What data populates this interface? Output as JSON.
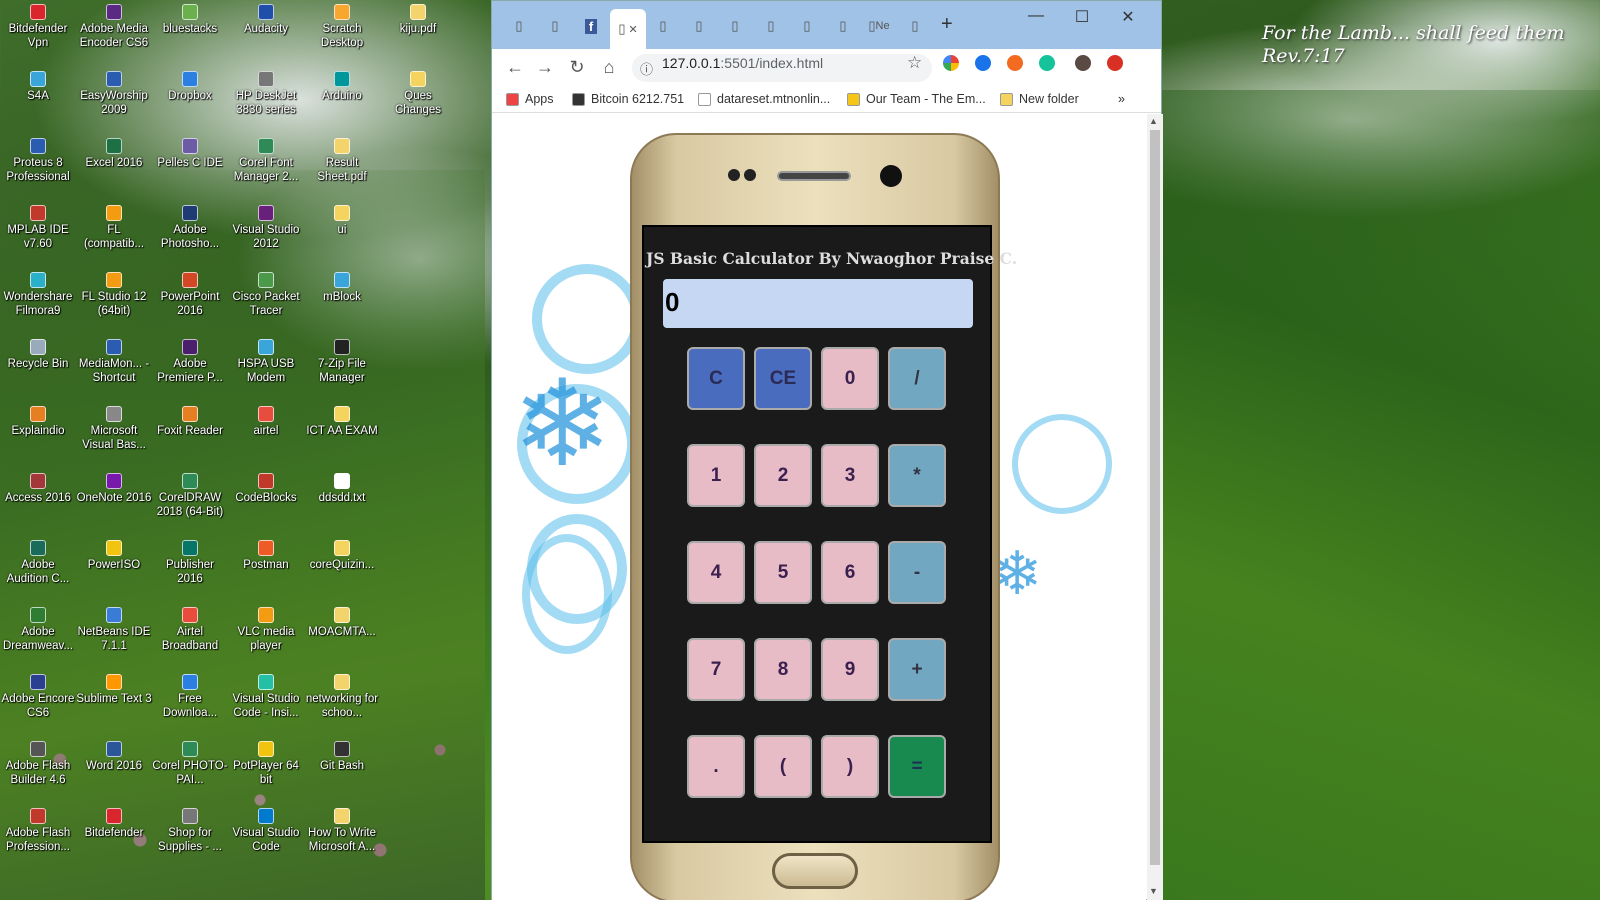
{
  "desktop": {
    "quote": "For the Lamb... shall feed them\nRev.7:17",
    "icons": [
      {
        "label": "Bitdefender Vpn",
        "icon": "bitdefender-vpn-icon",
        "color": "#d9262c"
      },
      {
        "label": "Adobe Media Encoder CS6",
        "icon": "adobe-media-encoder-icon",
        "color": "#5a2a82"
      },
      {
        "label": "bluestacks",
        "icon": "bluestacks-icon",
        "color": "#6ab04c"
      },
      {
        "label": "Audacity",
        "icon": "audacity-icon",
        "color": "#1f4fa8"
      },
      {
        "label": "Scratch Desktop",
        "icon": "scratch-icon",
        "color": "#f7a630"
      },
      {
        "label": "kiju.pdf",
        "icon": "pdf-file-icon",
        "color": "#f3d36b"
      },
      {
        "label": "S4A",
        "icon": "s4a-icon",
        "color": "#3aa5d8"
      },
      {
        "label": "EasyWorship 2009",
        "icon": "easyworship-icon",
        "color": "#2a5db0"
      },
      {
        "label": "Dropbox",
        "icon": "dropbox-icon",
        "color": "#2a7fe0"
      },
      {
        "label": "HP DeskJet 3830 series",
        "icon": "printer-icon",
        "color": "#777777"
      },
      {
        "label": "Arduino",
        "icon": "arduino-icon",
        "color": "#00979c"
      },
      {
        "label": "Ques Changes",
        "icon": "folder-icon",
        "color": "#f4d35e"
      },
      {
        "label": "Proteus 8 Professional",
        "icon": "proteus-icon",
        "color": "#2a5db0"
      },
      {
        "label": "Excel 2016",
        "icon": "excel-icon",
        "color": "#1d7044"
      },
      {
        "label": "Pelles C IDE",
        "icon": "pelles-c-icon",
        "color": "#6b5ca5"
      },
      {
        "label": "Corel Font Manager 2...",
        "icon": "corel-font-icon",
        "color": "#2e8b57"
      },
      {
        "label": "Result Sheet.pdf",
        "icon": "pdf-file-icon",
        "color": "#f3d36b"
      },
      {
        "label": "MPLAB IDE v7.60",
        "icon": "mplab-icon",
        "color": "#c0392b"
      },
      {
        "label": "FL (compatib...",
        "icon": "fl-studio-icon",
        "color": "#f39c12"
      },
      {
        "label": "Adobe Photosho...",
        "icon": "photoshop-icon",
        "color": "#1f3b73"
      },
      {
        "label": "Visual Studio 2012",
        "icon": "visual-studio-icon",
        "color": "#68217a"
      },
      {
        "label": "ui",
        "icon": "folder-icon",
        "color": "#f4d35e"
      },
      {
        "label": "Wondershare Filmora9",
        "icon": "filmora-icon",
        "color": "#2ab0c8"
      },
      {
        "label": "FL Studio 12 (64bit)",
        "icon": "fl-studio-icon",
        "color": "#f39c12"
      },
      {
        "label": "PowerPoint 2016",
        "icon": "powerpoint-icon",
        "color": "#d24726"
      },
      {
        "label": "Cisco Packet Tracer",
        "icon": "packet-tracer-icon",
        "color": "#4a9a4a"
      },
      {
        "label": "mBlock",
        "icon": "mblock-icon",
        "color": "#3aa5d8"
      },
      {
        "label": "Recycle Bin",
        "icon": "recycle-bin-icon",
        "color": "#9ab"
      },
      {
        "label": "MediaMon... - Shortcut",
        "icon": "mediamonkey-icon",
        "color": "#2a5db0"
      },
      {
        "label": "Adobe Premiere P...",
        "icon": "premiere-icon",
        "color": "#4a1f6b"
      },
      {
        "label": "HSPA USB Modem",
        "icon": "modem-icon",
        "color": "#3aa5d8"
      },
      {
        "label": "7-Zip File Manager",
        "icon": "7zip-icon",
        "color": "#222222"
      },
      {
        "label": "Explaindio",
        "icon": "explaindio-icon",
        "color": "#e67e22"
      },
      {
        "label": "Microsoft Visual Bas...",
        "icon": "visual-basic-icon",
        "color": "#888888"
      },
      {
        "label": "Foxit Reader",
        "icon": "foxit-icon",
        "color": "#e67e22"
      },
      {
        "label": "airtel",
        "icon": "airtel-icon",
        "color": "#e74c3c"
      },
      {
        "label": "ICT AA EXAM",
        "icon": "folder-icon",
        "color": "#f4d35e"
      },
      {
        "label": "Access 2016",
        "icon": "access-icon",
        "color": "#a4373a"
      },
      {
        "label": "OneNote 2016",
        "icon": "onenote-icon",
        "color": "#7719aa"
      },
      {
        "label": "CorelDRAW 2018 (64-Bit)",
        "icon": "coreldraw-icon",
        "color": "#2e8b57"
      },
      {
        "label": "CodeBlocks",
        "icon": "codeblocks-icon",
        "color": "#c0392b"
      },
      {
        "label": "ddsdd.txt",
        "icon": "text-file-icon",
        "color": "#ffffff"
      },
      {
        "label": "Adobe Audition C...",
        "icon": "audition-icon",
        "color": "#1a6b5a"
      },
      {
        "label": "PowerISO",
        "icon": "poweriso-icon",
        "color": "#f1c40f"
      },
      {
        "label": "Publisher 2016",
        "icon": "publisher-icon",
        "color": "#077568"
      },
      {
        "label": "Postman",
        "icon": "postman-icon",
        "color": "#ef5b25"
      },
      {
        "label": "coreQuizin...",
        "icon": "folder-icon",
        "color": "#f4d35e"
      },
      {
        "label": "Adobe Dreamweav...",
        "icon": "dreamweaver-icon",
        "color": "#2e7d32"
      },
      {
        "label": "NetBeans IDE 7.1.1",
        "icon": "netbeans-icon",
        "color": "#3a7bd5"
      },
      {
        "label": "Airtel Broadband",
        "icon": "airtel-icon",
        "color": "#e74c3c"
      },
      {
        "label": "VLC media player",
        "icon": "vlc-icon",
        "color": "#f39c12"
      },
      {
        "label": "MOACMTA...",
        "icon": "pdf-file-icon",
        "color": "#f3d36b"
      },
      {
        "label": "Adobe Encore CS6",
        "icon": "encore-icon",
        "color": "#2a3f8f"
      },
      {
        "label": "Sublime Text 3",
        "icon": "sublime-icon",
        "color": "#ff9800"
      },
      {
        "label": "Free Downloa...",
        "icon": "free-download-icon",
        "color": "#2a7fe0"
      },
      {
        "label": "Visual Studio Code - Insi...",
        "icon": "vscode-insiders-icon",
        "color": "#24bfa5"
      },
      {
        "label": "networking for schoo...",
        "icon": "pdf-file-icon",
        "color": "#f3d36b"
      },
      {
        "label": "Adobe Flash Builder 4.6",
        "icon": "flash-builder-icon",
        "color": "#555555"
      },
      {
        "label": "Word 2016",
        "icon": "word-icon",
        "color": "#2b579a"
      },
      {
        "label": "Corel PHOTO-PAI...",
        "icon": "corel-photo-paint-icon",
        "color": "#2e8b57"
      },
      {
        "label": "PotPlayer 64 bit",
        "icon": "potplayer-icon",
        "color": "#f1c40f"
      },
      {
        "label": "Git Bash",
        "icon": "git-bash-icon",
        "color": "#333333"
      },
      {
        "label": "Adobe Flash Profession...",
        "icon": "flash-professional-icon",
        "color": "#c0392b"
      },
      {
        "label": "Bitdefender",
        "icon": "bitdefender-icon",
        "color": "#d9262c"
      },
      {
        "label": "Shop for Supplies - ...",
        "icon": "shop-supplies-icon",
        "color": "#777777"
      },
      {
        "label": "Visual Studio Code",
        "icon": "vscode-icon",
        "color": "#007acc"
      },
      {
        "label": "How To Write Microsoft A...",
        "icon": "pdf-file-icon",
        "color": "#f3d36b"
      }
    ]
  },
  "browser": {
    "tabs": [
      {
        "label": "",
        "icon": "page-icon"
      },
      {
        "label": "",
        "icon": "site-icon"
      },
      {
        "label": "",
        "icon": "facebook-icon"
      },
      {
        "label": "",
        "icon": "page-icon",
        "active": true
      },
      {
        "label": "",
        "icon": "page-icon"
      },
      {
        "label": "",
        "icon": "page-icon"
      },
      {
        "label": "",
        "icon": "site-icon"
      },
      {
        "label": "",
        "icon": "page-icon"
      },
      {
        "label": "",
        "icon": "page-icon"
      },
      {
        "label": "",
        "icon": "page-icon"
      },
      {
        "label": "Ne",
        "icon": "page-icon"
      },
      {
        "label": "",
        "icon": "page-icon"
      }
    ],
    "url_host": "127.0.0.1",
    "url_rest": ":5501/index.html",
    "bookmarks": [
      {
        "label": "Apps",
        "icon": "apps-grid-icon",
        "color": "#e44"
      },
      {
        "label": "Bitcoin 6212.751",
        "icon": "bitcoin-icon",
        "color": "#333"
      },
      {
        "label": "datareset.mtnonlin...",
        "icon": "page-icon",
        "color": "#fff"
      },
      {
        "label": "Our Team - The Em...",
        "icon": "team-site-icon",
        "color": "#f5c518"
      },
      {
        "label": "New folder",
        "icon": "folder-icon",
        "color": "#f4d35e"
      }
    ],
    "more_bookmarks": "»"
  },
  "calculator": {
    "title": "JS Basic Calculator By Nwaoghor Praise C.",
    "display": "0",
    "keys": [
      {
        "label": "C",
        "kind": "clr"
      },
      {
        "label": "CE",
        "kind": "clr"
      },
      {
        "label": "0",
        "kind": "num"
      },
      {
        "label": "/",
        "kind": "op"
      },
      {
        "label": "1",
        "kind": "num"
      },
      {
        "label": "2",
        "kind": "num"
      },
      {
        "label": "3",
        "kind": "num"
      },
      {
        "label": "*",
        "kind": "op"
      },
      {
        "label": "4",
        "kind": "num"
      },
      {
        "label": "5",
        "kind": "num"
      },
      {
        "label": "6",
        "kind": "num"
      },
      {
        "label": "-",
        "kind": "op"
      },
      {
        "label": "7",
        "kind": "num"
      },
      {
        "label": "8",
        "kind": "num"
      },
      {
        "label": "9",
        "kind": "num"
      },
      {
        "label": "+",
        "kind": "op"
      },
      {
        "label": ".",
        "kind": "num"
      },
      {
        "label": "(",
        "kind": "num"
      },
      {
        "label": ")",
        "kind": "num"
      },
      {
        "label": "=",
        "kind": "eq"
      }
    ]
  }
}
